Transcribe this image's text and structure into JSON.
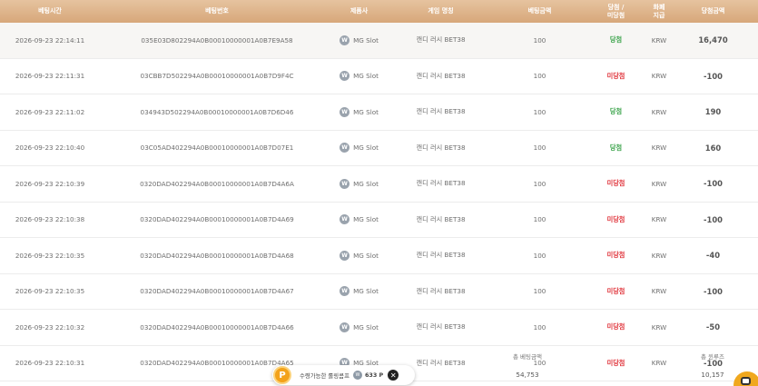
{
  "headers": {
    "bet_time": "베팅시간",
    "bet_number": "베팅번호",
    "provider": "제품사",
    "game_name": "게임 명칭",
    "bet_amount": "베팅금액",
    "result_line1": "당첨 /",
    "result_line2": "미당첨",
    "currency": "화폐 지급",
    "win_amount": "당첨금액"
  },
  "rows": [
    {
      "time": "2026-09-23 22:14:11",
      "number": "035E03D802294A0B00010000001A0B7E9A58",
      "provider": "MG Slot",
      "game": "캔디 러시 BET38",
      "amount": "100",
      "result": "당첨",
      "currency": "KRW",
      "win": "16,470"
    },
    {
      "time": "2026-09-23 22:11:31",
      "number": "03CBB7D502294A0B00010000001A0B7D9F4C",
      "provider": "MG Slot",
      "game": "캔디 러시 BET38",
      "amount": "100",
      "result": "미당첨",
      "currency": "KRW",
      "win": "-100"
    },
    {
      "time": "2026-09-23 22:11:02",
      "number": "034943D502294A0B00010000001A0B7D6D46",
      "provider": "MG Slot",
      "game": "캔디 러시 BET38",
      "amount": "100",
      "result": "당첨",
      "currency": "KRW",
      "win": "190"
    },
    {
      "time": "2026-09-23 22:10:40",
      "number": "03C05AD402294A0B00010000001A0B7D07E1",
      "provider": "MG Slot",
      "game": "캔디 러시 BET38",
      "amount": "100",
      "result": "당첨",
      "currency": "KRW",
      "win": "160"
    },
    {
      "time": "2026-09-23 22:10:39",
      "number": "0320DAD402294A0B00010000001A0B7D4A6A",
      "provider": "MG Slot",
      "game": "캔디 러시 BET38",
      "amount": "100",
      "result": "미당첨",
      "currency": "KRW",
      "win": "-100"
    },
    {
      "time": "2026-09-23 22:10:38",
      "number": "0320DAD402294A0B00010000001A0B7D4A69",
      "provider": "MG Slot",
      "game": "캔디 러시 BET38",
      "amount": "100",
      "result": "미당첨",
      "currency": "KRW",
      "win": "-100"
    },
    {
      "time": "2026-09-23 22:10:35",
      "number": "0320DAD402294A0B00010000001A0B7D4A68",
      "provider": "MG Slot",
      "game": "캔디 러시 BET38",
      "amount": "100",
      "result": "미당첨",
      "currency": "KRW",
      "win": "-40"
    },
    {
      "time": "2026-09-23 22:10:35",
      "number": "0320DAD402294A0B00010000001A0B7D4A67",
      "provider": "MG Slot",
      "game": "캔디 러시 BET38",
      "amount": "100",
      "result": "미당첨",
      "currency": "KRW",
      "win": "-100"
    },
    {
      "time": "2026-09-23 22:10:32",
      "number": "0320DAD402294A0B00010000001A0B7D4A66",
      "provider": "MG Slot",
      "game": "캔디 러시 BET38",
      "amount": "100",
      "result": "미당첨",
      "currency": "KRW",
      "win": "-50"
    },
    {
      "time": "2026-09-23 22:10:31",
      "number": "0320DAD402294A0B00010000001A0B7D4A65",
      "provider": "MG Slot",
      "game": "캔디 러시 BET38",
      "amount": "100",
      "result": "미당첨",
      "currency": "KRW",
      "win": "-100"
    }
  ],
  "summary": {
    "total_bet_label": "총 베팅금액",
    "total_bet_value": "54,753",
    "total_win_label": "총 윈루즈",
    "total_win_value": "10,157"
  },
  "coupon": {
    "badge": "P",
    "label": "수령가능한 롤링콤프",
    "amount": "633 P",
    "close": "✕"
  },
  "colors": {
    "header_gradient_top": "#e6c39f",
    "header_gradient_bottom": "#d7a77a",
    "win": "#3aa34a",
    "lose": "#e0343b",
    "coupon_badge": "#f3a21a"
  },
  "icons": {
    "provider_logo": "mg-logo-icon",
    "coupon_coin": "coin-icon",
    "close": "close-icon",
    "chat": "chat-icon"
  }
}
